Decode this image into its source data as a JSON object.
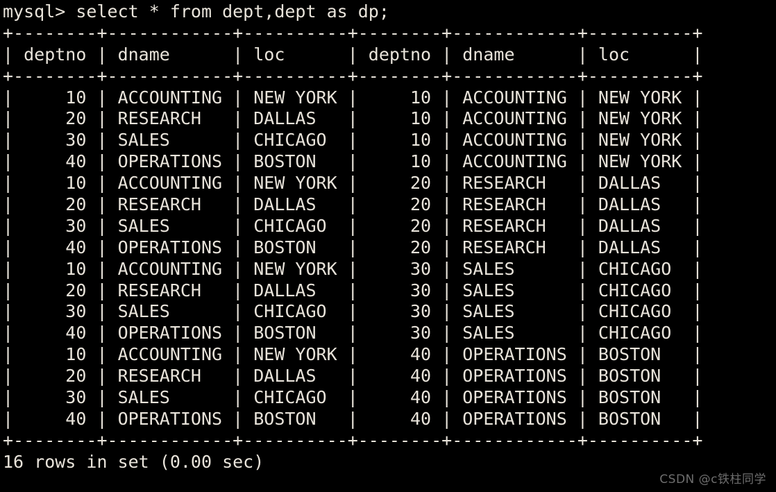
{
  "terminal": {
    "prompt": "mysql>",
    "query": "select * from dept,dept as dp;",
    "prompt_line": "mysql> select * from dept,dept as dp;",
    "status": "16 rows in set (0.00 sec)",
    "row_count": 16,
    "elapsed": "0.00 sec",
    "background_color": "#000000",
    "text_color": "#e8e3da"
  },
  "watermark": {
    "text": "CSDN @c铁柱同学",
    "color": "#6e6e6e"
  },
  "table": {
    "columns": [
      {
        "name": "deptno",
        "width": 6,
        "align": "right"
      },
      {
        "name": "dname",
        "width": 10,
        "align": "left"
      },
      {
        "name": "loc",
        "width": 8,
        "align": "left"
      },
      {
        "name": "deptno",
        "width": 6,
        "align": "right"
      },
      {
        "name": "dname",
        "width": 10,
        "align": "left"
      },
      {
        "name": "loc",
        "width": 8,
        "align": "left"
      }
    ],
    "headers": [
      "deptno",
      "dname",
      "loc",
      "deptno",
      "dname",
      "loc"
    ],
    "rows": [
      [
        "10",
        "ACCOUNTING",
        "NEW YORK",
        "10",
        "ACCOUNTING",
        "NEW YORK"
      ],
      [
        "20",
        "RESEARCH",
        "DALLAS",
        "10",
        "ACCOUNTING",
        "NEW YORK"
      ],
      [
        "30",
        "SALES",
        "CHICAGO",
        "10",
        "ACCOUNTING",
        "NEW YORK"
      ],
      [
        "40",
        "OPERATIONS",
        "BOSTON",
        "10",
        "ACCOUNTING",
        "NEW YORK"
      ],
      [
        "10",
        "ACCOUNTING",
        "NEW YORK",
        "20",
        "RESEARCH",
        "DALLAS"
      ],
      [
        "20",
        "RESEARCH",
        "DALLAS",
        "20",
        "RESEARCH",
        "DALLAS"
      ],
      [
        "30",
        "SALES",
        "CHICAGO",
        "20",
        "RESEARCH",
        "DALLAS"
      ],
      [
        "40",
        "OPERATIONS",
        "BOSTON",
        "20",
        "RESEARCH",
        "DALLAS"
      ],
      [
        "10",
        "ACCOUNTING",
        "NEW YORK",
        "30",
        "SALES",
        "CHICAGO"
      ],
      [
        "20",
        "RESEARCH",
        "DALLAS",
        "30",
        "SALES",
        "CHICAGO"
      ],
      [
        "30",
        "SALES",
        "CHICAGO",
        "30",
        "SALES",
        "CHICAGO"
      ],
      [
        "40",
        "OPERATIONS",
        "BOSTON",
        "30",
        "SALES",
        "CHICAGO"
      ],
      [
        "10",
        "ACCOUNTING",
        "NEW YORK",
        "40",
        "OPERATIONS",
        "BOSTON"
      ],
      [
        "20",
        "RESEARCH",
        "DALLAS",
        "40",
        "OPERATIONS",
        "BOSTON"
      ],
      [
        "30",
        "SALES",
        "CHICAGO",
        "40",
        "OPERATIONS",
        "BOSTON"
      ],
      [
        "40",
        "OPERATIONS",
        "BOSTON",
        "40",
        "OPERATIONS",
        "BOSTON"
      ]
    ]
  }
}
